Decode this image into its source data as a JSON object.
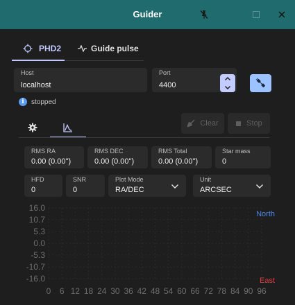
{
  "window": {
    "title": "Guider"
  },
  "tabs": [
    {
      "label": "PHD2",
      "active": true
    },
    {
      "label": "Guide pulse",
      "active": false
    }
  ],
  "connection": {
    "host_label": "Host",
    "host_value": "localhost",
    "port_label": "Port",
    "port_value": "4400",
    "status": "stopped"
  },
  "actions": {
    "clear_label": "Clear",
    "stop_label": "Stop"
  },
  "stats": {
    "rms_ra_label": "RMS RA",
    "rms_ra_value": "0.00 (0.00\")",
    "rms_dec_label": "RMS DEC",
    "rms_dec_value": "0.00 (0.00\")",
    "rms_total_label": "RMS Total",
    "rms_total_value": "0.00 (0.00\")",
    "star_mass_label": "Star mass",
    "star_mass_value": "0",
    "hfd_label": "HFD",
    "hfd_value": "0",
    "snr_label": "SNR",
    "snr_value": "0",
    "plot_mode_label": "Plot Mode",
    "plot_mode_value": "RA/DEC",
    "unit_label": "Unit",
    "unit_value": "ARCSEC"
  },
  "colors": {
    "titlebar": "#1f6b6e",
    "accent": "#c4ccff",
    "north": "#4a86e8",
    "east": "#e03c3c"
  },
  "chart_data": {
    "type": "line",
    "x_ticks": [
      "0",
      "6",
      "12",
      "18",
      "24",
      "30",
      "36",
      "42",
      "48",
      "54",
      "60",
      "66",
      "72",
      "78",
      "84",
      "90",
      "96"
    ],
    "y_ticks": [
      "16.0",
      "10.7",
      "5.3",
      "0.0",
      "-5.3",
      "-10.7",
      "-16.0"
    ],
    "xlim": [
      0,
      96
    ],
    "ylim": [
      -16,
      16
    ],
    "legend": [
      "North",
      "East"
    ],
    "series": [
      {
        "name": "North",
        "values": []
      },
      {
        "name": "East",
        "values": []
      }
    ]
  }
}
